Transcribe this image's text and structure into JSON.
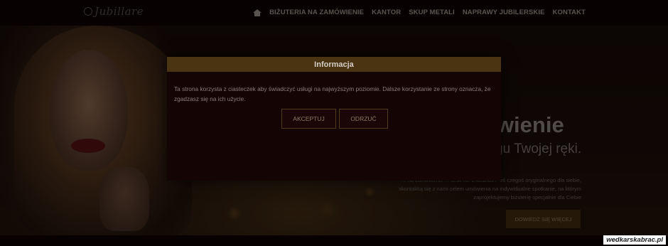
{
  "brand": {
    "logo_text": "Jubillare"
  },
  "nav": {
    "home_icon": "home-icon",
    "items": [
      {
        "label": "Biżuteria na zamówienie"
      },
      {
        "label": "Kantor"
      },
      {
        "label": "Skup metali"
      },
      {
        "label": "Naprawy jubilerskie"
      },
      {
        "label": "Kontakt"
      }
    ]
  },
  "hero": {
    "title_visible": "ówienie",
    "subtitle_visible": "gu Twojej ręki.",
    "text_visible": "... na zamówienie ... Jeśli nie znalazłaś / -eś czegoś oryginalnego dla siebie, skontaktuj się z nami celem umówienia na indywidualne spotkanie, na którym zaprojektujemy biżuterię specjalnie dla Ciebie",
    "button_label": "Dowiedz się więcej"
  },
  "modal": {
    "title": "Informacja",
    "body": "Ta strona korzysta z ciasteczek aby świadczyć usługi na najwyższym poziomie. Dalsze korzystanie ze strony oznacza, że zgadzasz się na ich użycie.",
    "accept_label": "Akceptuj",
    "reject_label": "Odrzuć"
  },
  "watermark": {
    "text": "wedkarskabrac.pl"
  },
  "colors": {
    "modal_header": "#4a3412",
    "modal_bg": "#140404",
    "accent": "#8c7a66"
  }
}
